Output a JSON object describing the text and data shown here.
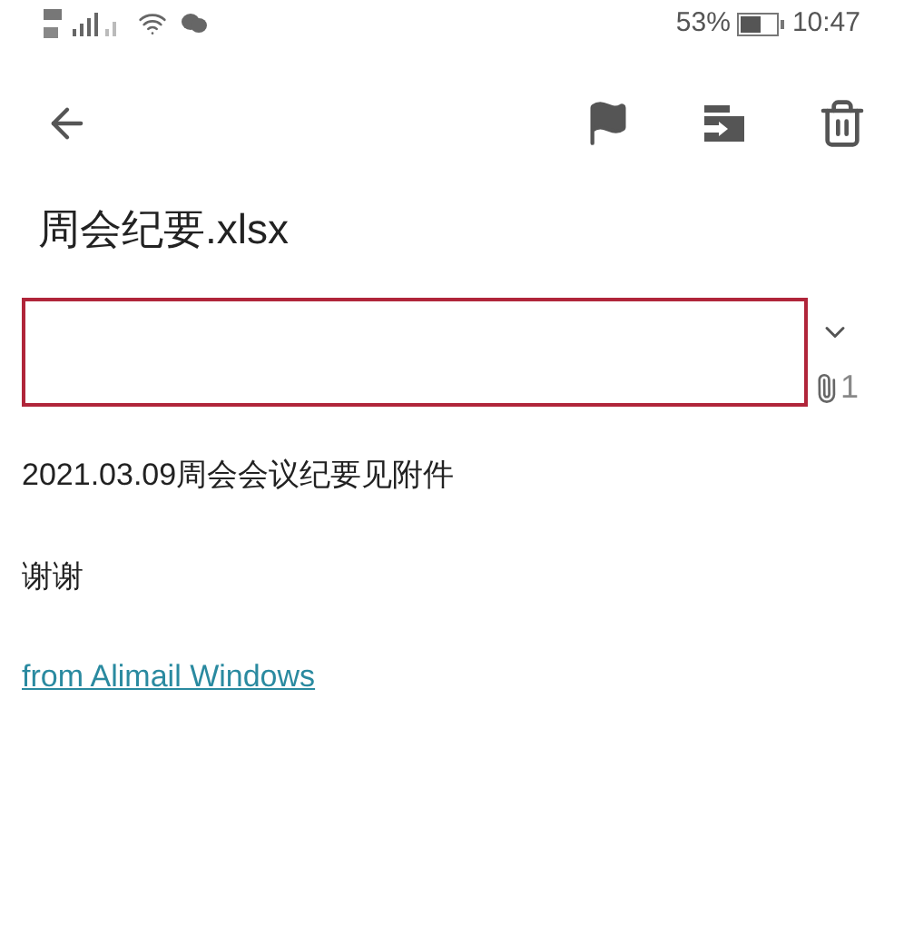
{
  "status_bar": {
    "battery": "53%",
    "time": "10:47"
  },
  "subject": "周会纪要.xlsx",
  "attachment_count": "1",
  "body": [
    "2021.03.09周会会议纪要见附件",
    "谢谢"
  ],
  "signature_link": "from Alimail Windows"
}
